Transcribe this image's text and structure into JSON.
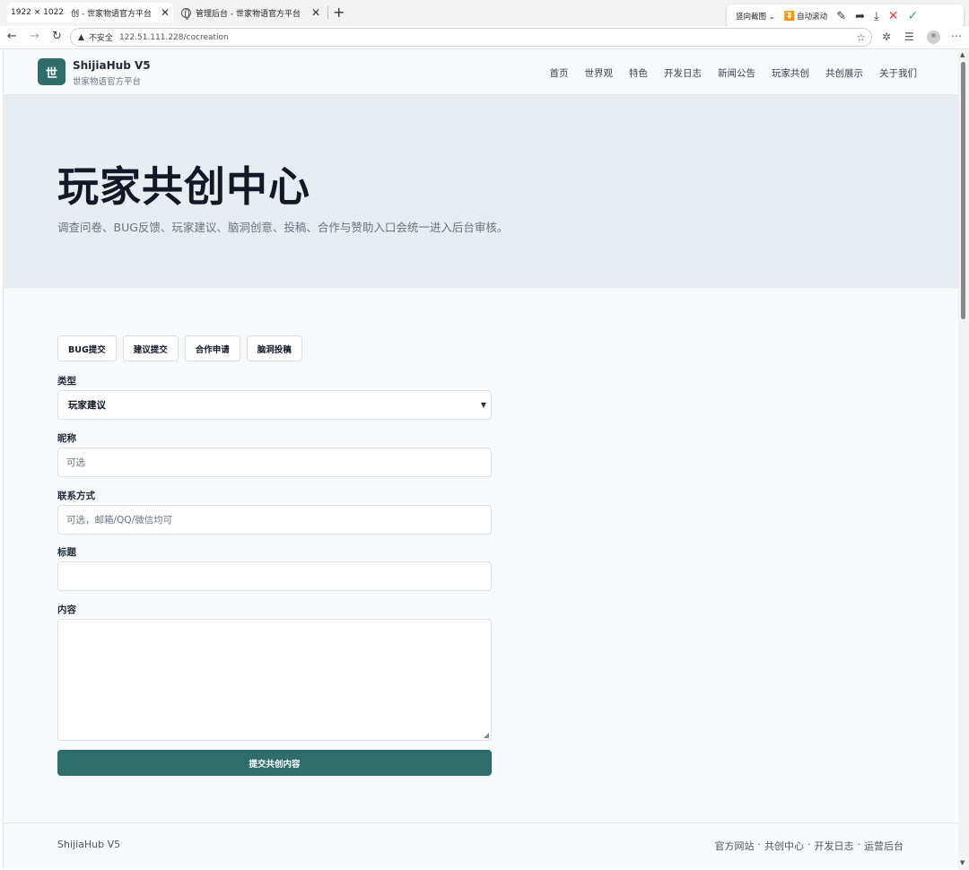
{
  "browser": {
    "dimension_label": "1922 × 1022",
    "tabs": [
      {
        "title": "创 - 世家物语官方平台"
      },
      {
        "title": "管理后台 - 世家物语官方平台"
      }
    ],
    "toolbar": {
      "capture_mode": "竖向截图",
      "auto_scroll": "自动滚动"
    },
    "address": {
      "insecure_label": "不安全",
      "url": "122.51.111.228/cocreation"
    }
  },
  "header": {
    "logo_char": "世",
    "brand_name": "ShijiaHub V5",
    "brand_sub": "世家物语官方平台",
    "nav": [
      "首页",
      "世界观",
      "特色",
      "开发日志",
      "新闻公告",
      "玩家共创",
      "共创展示",
      "关于我们"
    ]
  },
  "hero": {
    "title": "玩家共创中心",
    "subtitle": "调查问卷、BUG反馈、玩家建议、脑洞创意、投稿、合作与赞助入口会统一进入后台审核。"
  },
  "form": {
    "chips": [
      "BUG提交",
      "建议提交",
      "合作申请",
      "脑洞投稿"
    ],
    "type_label": "类型",
    "type_value": "玩家建议",
    "nickname_label": "昵称",
    "nickname_placeholder": "可选",
    "contact_label": "联系方式",
    "contact_placeholder": "可选，邮箱/QQ/微信均可",
    "title_label": "标题",
    "content_label": "内容",
    "submit_label": "提交共创内容"
  },
  "footer": {
    "brand": "ShijiaHub V5",
    "links": [
      "官方网站",
      "共创中心",
      "开发日志",
      "运营后台"
    ],
    "separator": "·"
  },
  "colors": {
    "accent": "#2f6d6b",
    "hero_bg": "#e8edf2",
    "page_bg": "#f8fafc"
  }
}
